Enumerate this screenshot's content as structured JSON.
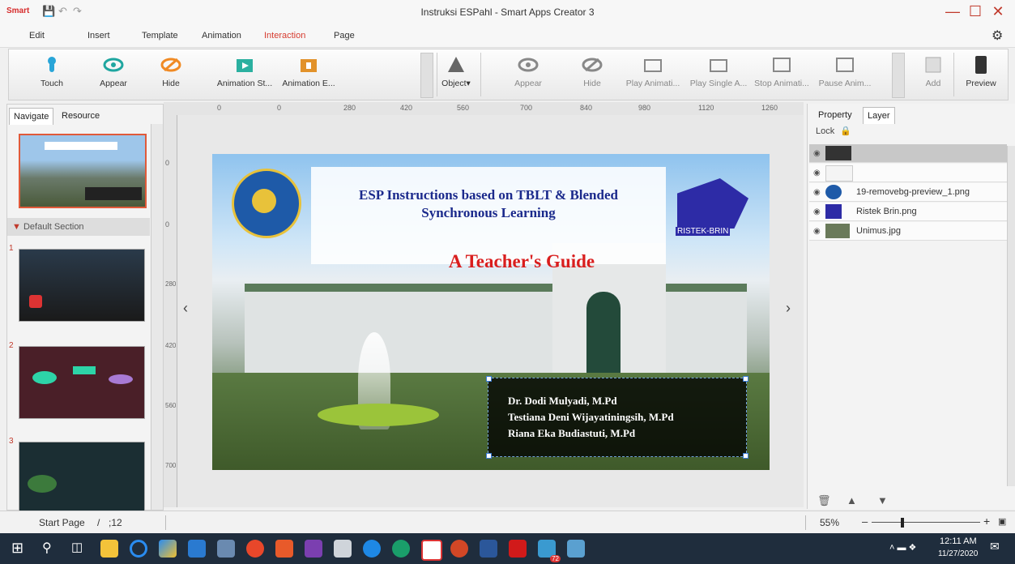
{
  "window": {
    "app_logo": "Smart",
    "title": "Instruksi ESPahl - Smart Apps Creator 3",
    "controls": [
      "—",
      "☐",
      "✕"
    ]
  },
  "menu": [
    "Edit",
    "Insert",
    "Template",
    "Animation",
    "Interaction",
    "Page"
  ],
  "active_menu": "Interaction",
  "ribbon": {
    "group1": [
      "Touch",
      "Appear",
      "Hide",
      "Animation St...",
      "Animation E..."
    ],
    "object_label": "Object",
    "group2": [
      "Appear",
      "Hide",
      "Play Animati...",
      "Play Single A...",
      "Stop Animati...",
      "Pause Anim..."
    ],
    "add_label": "Add",
    "preview_label": "Preview"
  },
  "left_panel": {
    "tabs": [
      "Navigate",
      "Resource"
    ],
    "section_label": "Default Section",
    "page_numbers": [
      "1",
      "2",
      "3"
    ]
  },
  "rulers": {
    "top_ticks": [
      "0",
      "0",
      "280",
      "420",
      "560",
      "700",
      "840",
      "980",
      "1120",
      "1260"
    ],
    "left_ticks": [
      "0",
      "0",
      "280",
      "420",
      "560",
      "700"
    ]
  },
  "slide": {
    "title_line1": "ESP Instructions based on TBLT & Blended",
    "title_line2": "Synchronous Learning",
    "subtitle": "A Teacher's Guide",
    "authors": [
      "Dr. Dodi Mulyadi, M.Pd",
      "Testiana Deni Wijayatiningsih, M.Pd",
      "Riana Eka Budiastuti, M.Pd"
    ],
    "logo_text": "RISTEK-BRIN"
  },
  "right_panel": {
    "tabs": [
      "Property",
      "Layer"
    ],
    "lock_label": "Lock",
    "layers": [
      "",
      "",
      "19-removebg-preview_1.png",
      "Ristek Brin.png",
      "Unimus.jpg"
    ]
  },
  "status": {
    "page_label": "Start Page",
    "page_sep": "/",
    "page_count": ";12",
    "zoom": "55%"
  },
  "taskbar": {
    "time": "12:11 AM",
    "date": "11/27/2020",
    "badge": "72",
    "notif": "2"
  },
  "colors": {
    "accent": "#d63b2f",
    "slide_title": "#1b2a8c",
    "slide_subtitle": "#d91e1e",
    "taskbar": "#1f2d3d"
  }
}
